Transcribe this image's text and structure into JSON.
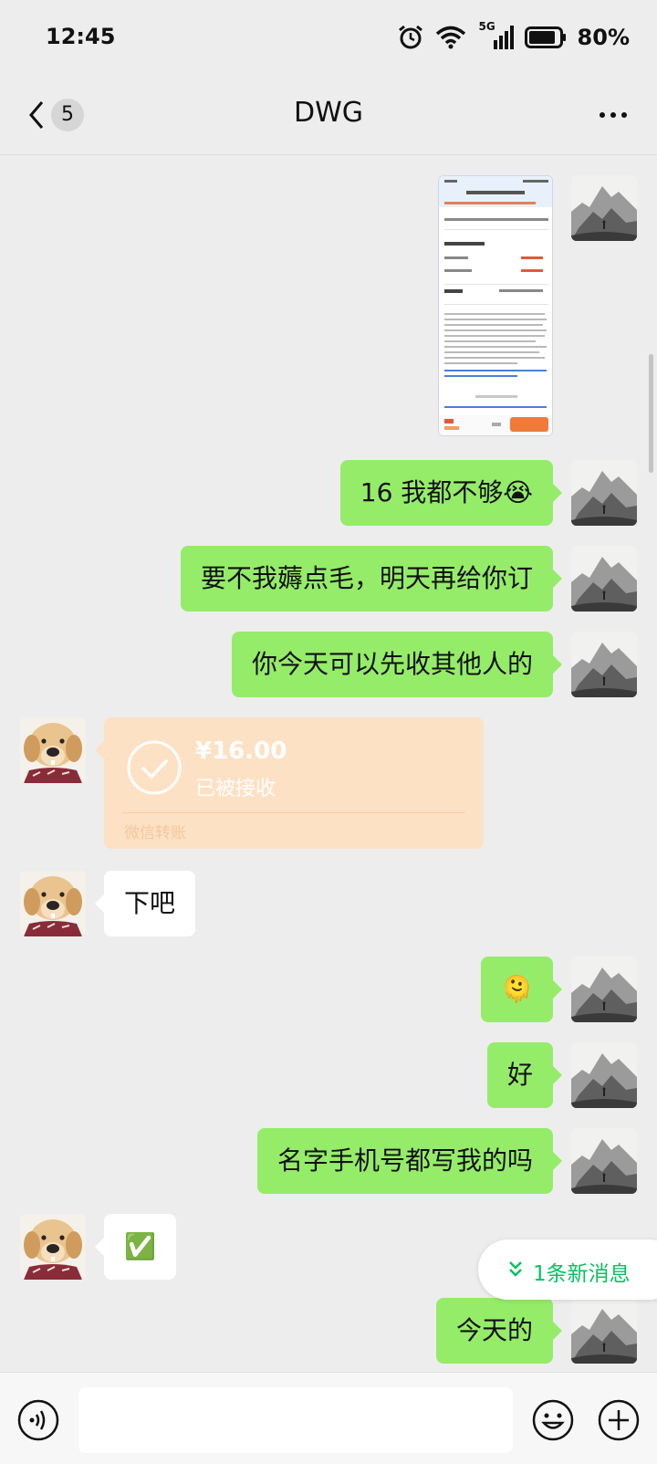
{
  "status_bar": {
    "time": "12:45",
    "network_label": "5G",
    "battery_percent": "80%",
    "icons": [
      "alarm-icon",
      "wifi-icon",
      "signal-icon",
      "battery-icon"
    ]
  },
  "header": {
    "unread_count": "5",
    "title": "DWG"
  },
  "messages": [
    {
      "direction": "out",
      "type": "image"
    },
    {
      "direction": "out",
      "type": "text",
      "text": "16 我都不够",
      "emoji": "😭"
    },
    {
      "direction": "out",
      "type": "text",
      "text": "要不我薅点毛，明天再给你订"
    },
    {
      "direction": "out",
      "type": "text",
      "text": "你今天可以先收其他人的"
    },
    {
      "direction": "in",
      "type": "transfer",
      "amount": "¥16.00",
      "status": "已被接收",
      "label": "微信转账"
    },
    {
      "direction": "in",
      "type": "text",
      "text": "下吧"
    },
    {
      "direction": "out",
      "type": "emoji",
      "emoji": "🫠"
    },
    {
      "direction": "out",
      "type": "text",
      "text": "好"
    },
    {
      "direction": "out",
      "type": "text",
      "text": "名字手机号都写我的吗"
    },
    {
      "direction": "in",
      "type": "emoji",
      "emoji": "✅"
    },
    {
      "direction": "out",
      "type": "text",
      "text": "今天的"
    }
  ],
  "new_message_pill": {
    "text": "1条新消息"
  },
  "input_bar": {
    "value": "",
    "placeholder": ""
  },
  "colors": {
    "background": "#ededed",
    "outgoing_bubble": "#95ec69",
    "incoming_bubble": "#ffffff",
    "transfer_card": "#fde1c4",
    "accent_green": "#07c160"
  }
}
